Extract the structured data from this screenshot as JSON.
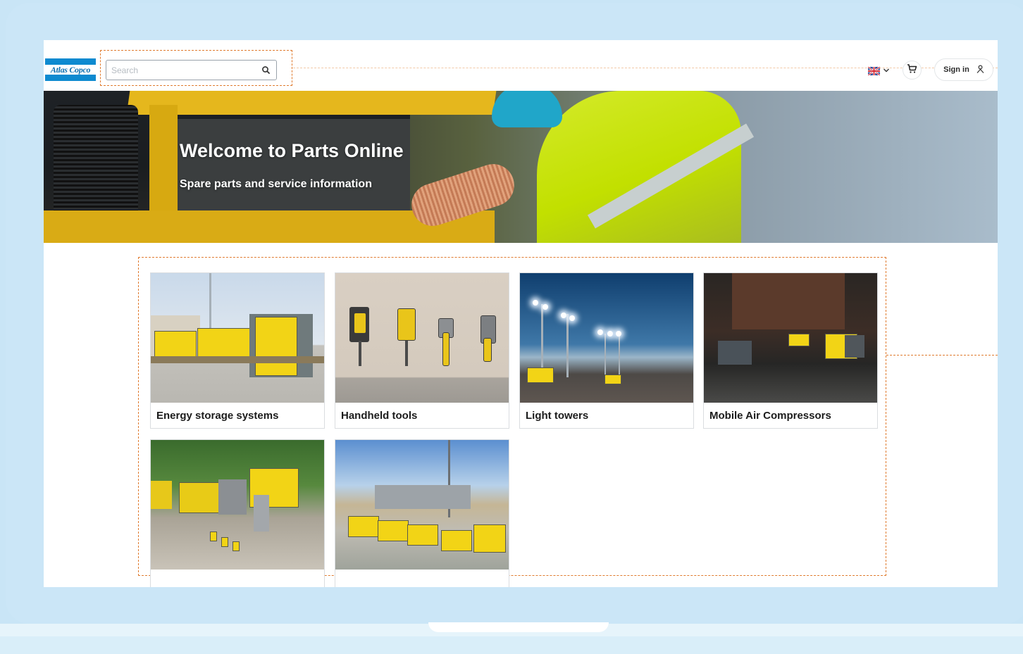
{
  "brand": {
    "logo_text": "Atlas Copco",
    "accent": "#0d8ad0"
  },
  "search": {
    "placeholder": "Search",
    "value": "",
    "icon": "search-icon"
  },
  "header": {
    "language_icon": "uk-flag-icon",
    "cart_icon": "cart-icon",
    "signin_label": "Sign in",
    "signin_icon": "user-icon"
  },
  "hero": {
    "title": "Welcome to Parts Online",
    "subtitle": "Spare parts and service information"
  },
  "categories": [
    {
      "label": "Energy storage systems"
    },
    {
      "label": "Handheld tools"
    },
    {
      "label": "Light towers"
    },
    {
      "label": "Mobile Air Compressors"
    },
    {
      "label": ""
    },
    {
      "label": ""
    }
  ],
  "colors": {
    "highlight_border": "#e07b2f",
    "frame_background": "#c9e5f6",
    "product_yellow": "#f2d416"
  }
}
